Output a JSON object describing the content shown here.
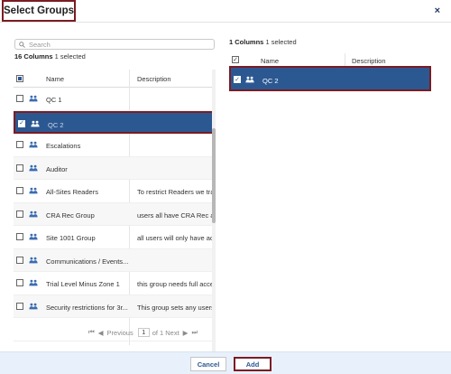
{
  "dialog": {
    "title": "Select Groups",
    "close_label": "×"
  },
  "left": {
    "search_placeholder": "Search",
    "count_bold": "16 Columns",
    "count_rest": "1 selected",
    "columns": {
      "name": "Name",
      "description": "Description"
    },
    "rows": [
      {
        "name": "QC 1",
        "description": "",
        "checked": false
      },
      {
        "name": "QC 2",
        "description": "",
        "checked": true
      },
      {
        "name": "Escalations",
        "description": "",
        "checked": false
      },
      {
        "name": "Auditor",
        "description": "",
        "checked": false
      },
      {
        "name": "All-Sites Readers",
        "description": "To restrict Readers we tra",
        "checked": false
      },
      {
        "name": "CRA Rec Group",
        "description": "users all have CRA Rec ac",
        "checked": false
      },
      {
        "name": "Site 1001 Group",
        "description": "all users will only have ac",
        "checked": false
      },
      {
        "name": "Communications / Events...",
        "description": "",
        "checked": false
      },
      {
        "name": "Trial Level Minus Zone 1",
        "description": "this group needs full acce",
        "checked": false
      },
      {
        "name": "Security restrictions for 3r...",
        "description": "This group sets any users",
        "checked": false
      },
      {
        "name": "",
        "description": "",
        "checked": false
      }
    ],
    "pager": {
      "prev": "Previous",
      "page": "1",
      "of": "of 1",
      "next": "Next"
    }
  },
  "right": {
    "count_bold": "1 Columns",
    "count_rest": "1 selected",
    "columns": {
      "name": "Name",
      "description": "Description"
    },
    "rows": [
      {
        "name": "QC 2",
        "description": ""
      }
    ]
  },
  "footer": {
    "cancel": "Cancel",
    "add": "Add"
  },
  "colors": {
    "selection": "#2c5892",
    "highlight_border": "#7a1c24",
    "footer_bg": "#e8f0fb"
  },
  "icons": {
    "group": "group-icon",
    "search": "search-icon",
    "close": "close-icon"
  }
}
